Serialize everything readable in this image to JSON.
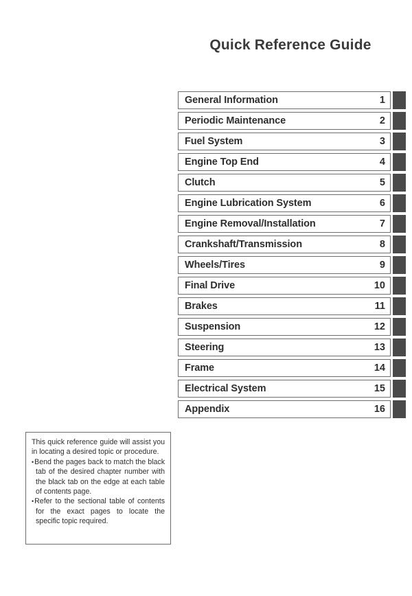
{
  "document": {
    "title": "Quick Reference Guide"
  },
  "toc": {
    "rows": [
      {
        "label": "General Information",
        "number": "1"
      },
      {
        "label": "Periodic Maintenance",
        "number": "2"
      },
      {
        "label": "Fuel System",
        "number": "3"
      },
      {
        "label": "Engine Top End",
        "number": "4"
      },
      {
        "label": "Clutch",
        "number": "5"
      },
      {
        "label": "Engine Lubrication System",
        "number": "6"
      },
      {
        "label": "Engine Removal/Installation",
        "number": "7"
      },
      {
        "label": "Crankshaft/Transmission",
        "number": "8"
      },
      {
        "label": "Wheels/Tires",
        "number": "9"
      },
      {
        "label": "Final Drive",
        "number": "10"
      },
      {
        "label": "Brakes",
        "number": "11"
      },
      {
        "label": "Suspension",
        "number": "12"
      },
      {
        "label": "Steering",
        "number": "13"
      },
      {
        "label": "Frame",
        "number": "14"
      },
      {
        "label": "Electrical System",
        "number": "15"
      },
      {
        "label": "Appendix",
        "number": "16"
      }
    ]
  },
  "note": {
    "intro": "This quick reference guide will assist you in locating a desired topic or procedure.",
    "bullets": [
      "Bend the pages back to match the black tab of the desired chapter number with the black tab on the edge at each table of contents page.",
      "Refer to the sectional table of contents for the exact pages to locate the specific topic required."
    ]
  },
  "colors": {
    "page_background": "#ffffff",
    "text": "#2e2e2e",
    "border": "#6d6d6d",
    "chapter_tab": "#4a4a4a"
  }
}
